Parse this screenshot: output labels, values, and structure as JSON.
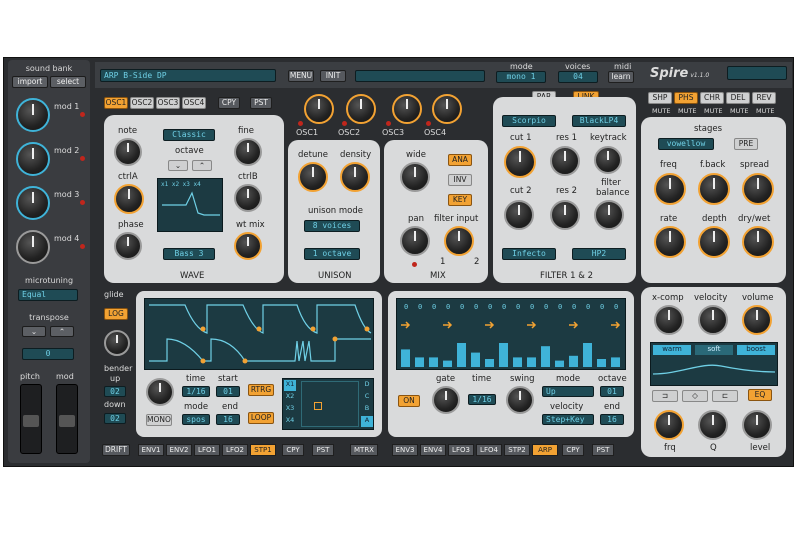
{
  "left": {
    "sound_bank": "sound bank",
    "import": "import",
    "select": "select",
    "mod1": "mod 1",
    "mod2": "mod 2",
    "mod3": "mod 3",
    "mod4": "mod 4",
    "microtuning": "microtuning",
    "tuning": "Equal",
    "transpose": "transpose",
    "transpose_val": "0",
    "pitch": "pitch",
    "mod": "mod"
  },
  "top": {
    "preset": "ARP B-Side DP",
    "menu": "MENU",
    "init": "INIT",
    "mode_label": "mode",
    "mode_val": "mono 1",
    "voices_label": "voices",
    "voices_val": "04",
    "midi_label": "midi",
    "midi_btn": "learn",
    "logo": "Spire",
    "version": "v1.1.0"
  },
  "osc": {
    "tabs": [
      "OSC1",
      "OSC2",
      "OSC3",
      "OSC4"
    ],
    "cpy": "CPY",
    "pst": "PST",
    "knob_labels": [
      "OSC1",
      "OSC2",
      "OSC3",
      "OSC4"
    ]
  },
  "wave": {
    "note": "note",
    "fine": "fine",
    "wave_type": "Classic",
    "octave": "octave",
    "ctrlA": "ctrlA",
    "ctrlB": "ctrlB",
    "phase": "phase",
    "wtmix": "wt mix",
    "wave_sel": "Bass 3",
    "title": "WAVE",
    "screen_text": "x1 x2 x3 x4"
  },
  "unison": {
    "detune": "detune",
    "density": "density",
    "mode": "unison mode",
    "mode_val": "8 voices",
    "oct_val": "1 octave",
    "title": "UNISON"
  },
  "mix": {
    "wide": "wide",
    "ana": "ANA",
    "inv": "INV",
    "key": "KEY",
    "pan": "pan",
    "filter_input": "filter input",
    "one": "1",
    "two": "2",
    "title": "MIX"
  },
  "filter": {
    "par": "PAR",
    "link": "LINK",
    "f1_type": "Scorpio",
    "f1_mode": "BlackLP4",
    "cut1": "cut 1",
    "res1": "res 1",
    "keytrack": "keytrack",
    "cut2": "cut 2",
    "res2": "res 2",
    "balance": "filter balance",
    "f2_type": "Infecto",
    "f2_mode": "HP2",
    "title": "FILTER 1 & 2"
  },
  "fx": {
    "tabs": [
      "SHP",
      "PHS",
      "CHR",
      "DEL",
      "REV"
    ],
    "mute": "MUTE",
    "stages": "stages",
    "stage_val": "vowellow",
    "pre": "PRE",
    "freq": "freq",
    "fback": "f.back",
    "spread": "spread",
    "rate": "rate",
    "depth": "depth",
    "drywet": "dry/wet"
  },
  "eq": {
    "xcomp": "x-comp",
    "velocity": "velocity",
    "volume": "volume",
    "warm": "warm",
    "soft": "soft",
    "boost": "boost",
    "eq_btn": "EQ",
    "frq": "frq",
    "q": "Q",
    "level": "level"
  },
  "stepseq": {
    "glide": "glide",
    "log": "LOG",
    "bender": "bender",
    "up": "up",
    "up_val": "02",
    "down": "down",
    "down_val": "02",
    "mono": "MONO",
    "time": "time",
    "time_val": "1/16",
    "start": "start",
    "start_val": "01",
    "rtrg": "RTRG",
    "mode": "mode",
    "mode_val": "spos",
    "end": "end",
    "end_val": "16",
    "loop": "LOOP",
    "x": [
      "X1",
      "X2",
      "X3",
      "X4"
    ],
    "abcd": [
      "A",
      "B",
      "C",
      "D"
    ],
    "drift": "DRIFT",
    "tabs": [
      "ENV1",
      "ENV2",
      "LFO1",
      "LFO2",
      "STP1"
    ],
    "cpy": "CPY",
    "pst": "PST",
    "mtrx": "MTRX"
  },
  "arp": {
    "on": "ON",
    "gate": "gate",
    "time": "time",
    "time_val": "1/16",
    "swing": "swing",
    "mode": "mode",
    "mode_val": "Up",
    "octave": "octave",
    "octave_val": "01",
    "velocity": "velocity",
    "vel_val": "Step+Key",
    "end": "end",
    "end_val": "16",
    "tabs": [
      "ENV3",
      "ENV4",
      "LFO3",
      "LFO4",
      "STP2",
      "ARP"
    ],
    "cpy": "CPY",
    "pst": "PST",
    "steps": [
      0.55,
      0.3,
      0.3,
      0.2,
      0.75,
      0.45,
      0.25,
      0.75,
      0.3,
      0.3,
      0.65,
      0.2,
      0.35,
      0.75,
      0.25,
      0.3
    ],
    "row_digits": "0"
  }
}
